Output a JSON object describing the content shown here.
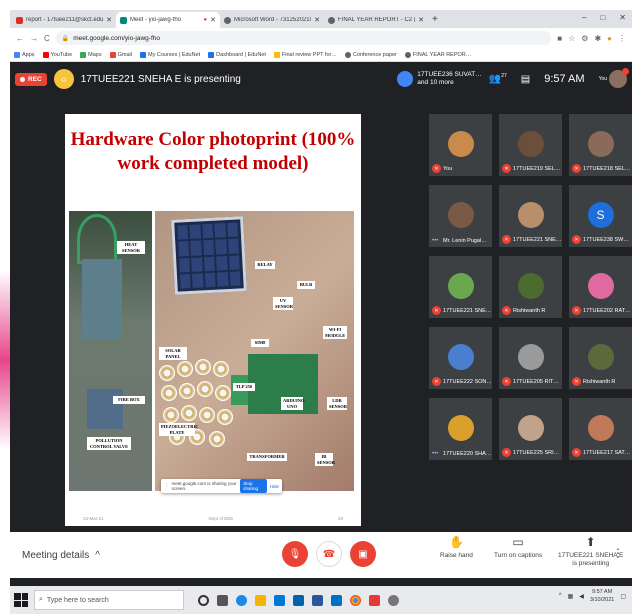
{
  "tabs": [
    {
      "title": "report - 17tuee211@skct.edu.in",
      "fav": "#d93025",
      "active": false
    },
    {
      "title": "Meet - yio-jawg-fho",
      "fav": "#00897b",
      "active": true
    },
    {
      "title": "Microsoft Word - 73125202100 …",
      "fav": "#5f6368",
      "active": false
    },
    {
      "title": "FINAL YEAR REPORT - C2 (1).pdf",
      "fav": "#5f6368",
      "active": false
    }
  ],
  "window": {
    "minimize": "–",
    "maximize": "□",
    "close": "✕"
  },
  "address": {
    "url": "meet.google.com/yio-jawg-fho"
  },
  "bookmarks": [
    "Apps",
    "YouTube",
    "Maps",
    "Gmail",
    "My Courses | EduNet",
    "Dashboard | EduNet",
    "Final review PPT for…",
    "Conference paper",
    "FINAL YEAR REPOR…"
  ],
  "meet": {
    "rec_label": "REC",
    "presenter_text": "17TUEE221 SNEHA E is presenting",
    "pinned_line1": "17TUEE236 SUVAT…",
    "pinned_line2": "and 10 more",
    "people_count": "27",
    "time": "9:57 AM",
    "you_label": "You"
  },
  "slide": {
    "title": "Hardware Color photoprint (100% work completed model)",
    "labels": {
      "heat": "HEAT SENSOR",
      "solar": "SOLAR PANEL",
      "relay": "RELAY",
      "bulb": "BULB",
      "uv": "UV SENSOR",
      "wifi": "WI-FI MODULE",
      "sim": "SIM8",
      "tlp": "TLP 250",
      "arduino": "ARDUINO UNO",
      "ldr": "LDR SENSOR",
      "firebox": "FIRE BOX",
      "pollution": "POLLUTION CONTROL VALVE",
      "piezo": "PIEZOELECTRIC PLATE",
      "transformer": "TRANSFORMER",
      "ir": "IR SENSOR"
    },
    "share_text": "meet.google.com is sharing your screen.",
    "stop_label": "Stop sharing",
    "hide_label": "Hide",
    "footer_date": "13-Mar-21",
    "footer_dept": "Dept of EEE",
    "footer_page": "29"
  },
  "participants": [
    {
      "name": "You",
      "mic": "muted",
      "color": "#c98a4b"
    },
    {
      "name": "17TUEE219 SEL…",
      "mic": "muted",
      "color": "#6b4f3a"
    },
    {
      "name": "17TUEE218 SEL…",
      "mic": "muted",
      "color": "#8a6a5a"
    },
    {
      "name": "Mr. Lenin Pugal…",
      "mic": "live",
      "color": "#7b5a45"
    },
    {
      "name": "17TUEE221 SNE…",
      "mic": "muted",
      "color": "#b88f6b"
    },
    {
      "name": "17TUEE238 SW…",
      "mic": "muted",
      "color": "#1e6fd9",
      "initial": "S"
    },
    {
      "name": "17TUEE221 SNE…",
      "mic": "muted",
      "color": "#6aa84f"
    },
    {
      "name": "Rishiwanth R",
      "mic": "muted",
      "color": "#4b6b2f"
    },
    {
      "name": "17TUEE202 RAT…",
      "mic": "muted",
      "color": "#e06aa0"
    },
    {
      "name": "17TUEE222 SON…",
      "mic": "muted",
      "color": "#4a7fd0"
    },
    {
      "name": "17TUEE205 RIT…",
      "mic": "muted",
      "color": "#9a9a9a"
    },
    {
      "name": "Rishiwanth R",
      "mic": "muted",
      "color": "#5a6a3a"
    },
    {
      "name": "17TUEE220 SHA…",
      "mic": "live",
      "color": "#d9a02c"
    },
    {
      "name": "17TUEE225 SRI…",
      "mic": "muted",
      "color": "#c2a38a"
    },
    {
      "name": "17TUEE217 SAT…",
      "mic": "muted",
      "color": "#c07a5a"
    }
  ],
  "bottom": {
    "meeting_details": "Meeting details",
    "raise_hand": "Raise hand",
    "captions": "Turn on captions",
    "presenting_line1": "17TUEE221 SNEHA E",
    "presenting_line2": "is presenting"
  },
  "taskbar": {
    "search_placeholder": "Type here to search",
    "time": "9:57 AM",
    "date": "3/10/2021"
  }
}
